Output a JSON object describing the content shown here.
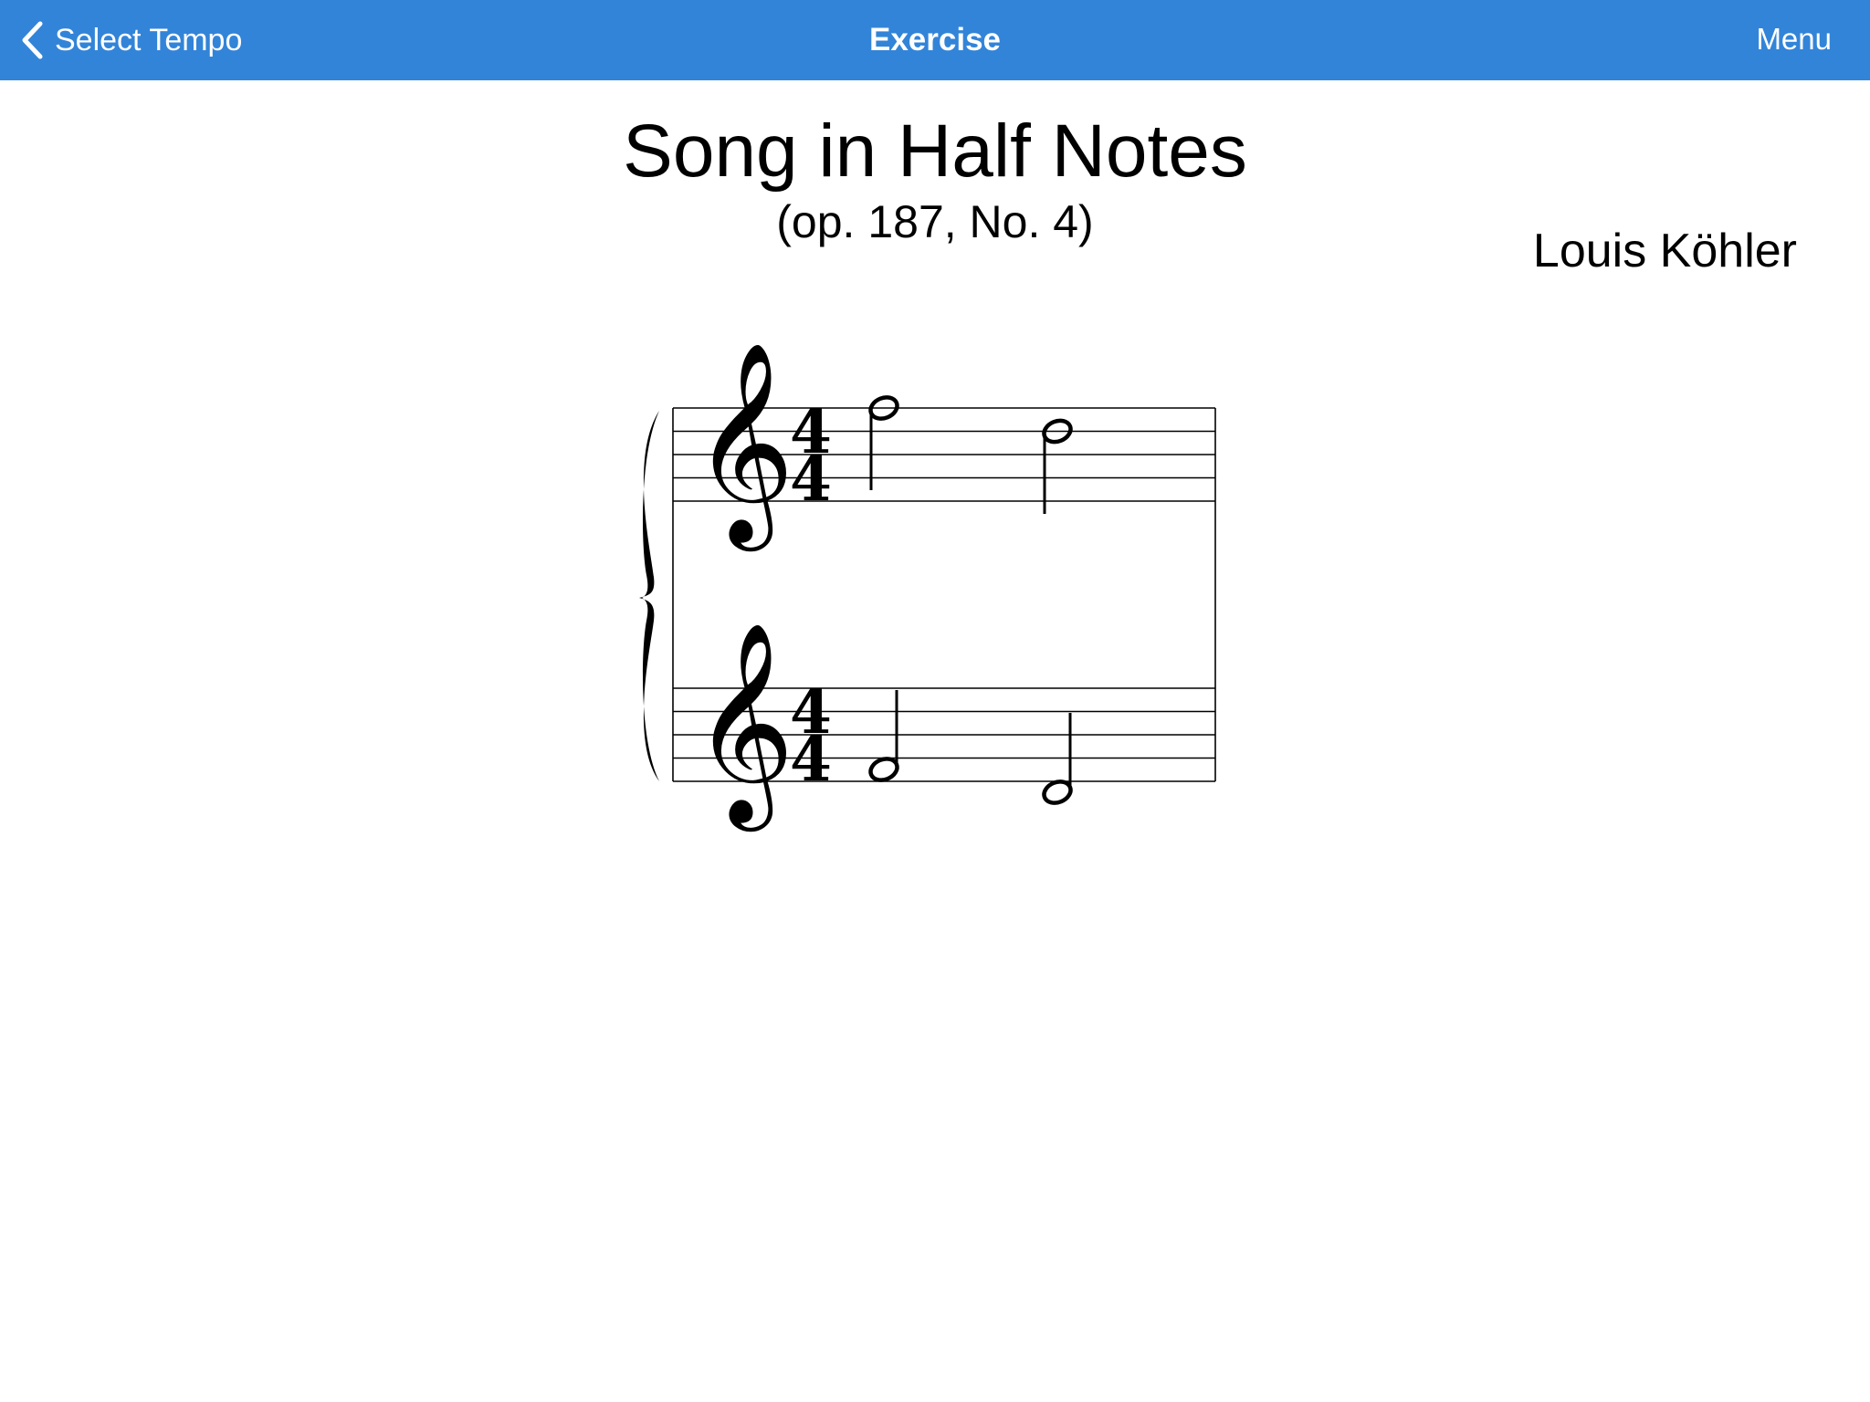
{
  "navbar": {
    "back_label": "Select Tempo",
    "title": "Exercise",
    "menu_label": "Menu",
    "background_color": "#3284d8",
    "back_icon": "chevron-left-icon"
  },
  "score": {
    "title": "Song in Half Notes",
    "subtitle": "(op. 187, No. 4)",
    "composer": "Louis Köhler",
    "time_signature": {
      "numerator": "4",
      "denominator": "4"
    },
    "staves": [
      {
        "name": "upper",
        "clef": "treble",
        "notes": [
          {
            "pitch": "F5",
            "duration": "half"
          },
          {
            "pitch": "D5",
            "duration": "half"
          }
        ]
      },
      {
        "name": "lower",
        "clef": "treble",
        "notes": [
          {
            "pitch": "F4",
            "duration": "half"
          },
          {
            "pitch": "D4",
            "duration": "half"
          }
        ]
      }
    ]
  }
}
